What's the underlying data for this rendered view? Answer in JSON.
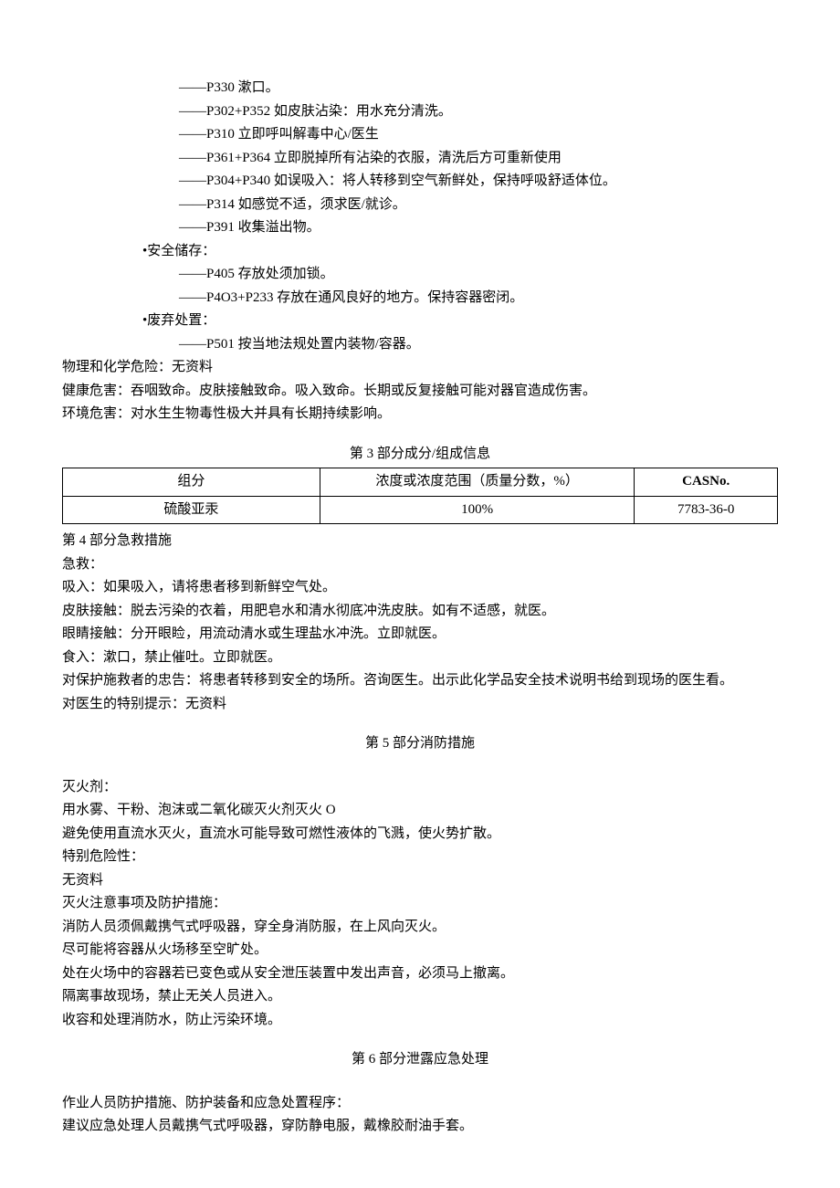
{
  "response_lines": [
    "——P330 漱口。",
    "",
    "——P302+P352 如皮肤沾染：用水充分清洗。",
    "——P310 立即呼叫解毒中心/医生",
    "——P361+P364 立即脱掉所有沾染的衣服，清洗后方可重新使用",
    "——P304+P340 如误吸入：将人转移到空气新鲜处，保持呼吸舒适体位。",
    "——P314 如感觉不适，须求医/就诊。",
    "——P391 收集溢出物。"
  ],
  "storage_label": "•安全储存：",
  "storage_lines": [
    "——P405 存放处须加锁。",
    "——P4O3+P233 存放在通风良好的地方。保持容器密闭。"
  ],
  "disposal_label": "•废弃处置：",
  "disposal_lines": [
    "——P501 按当地法规处置内装物/容器。"
  ],
  "hazard_lines": [
    "物理和化学危险：无资料",
    "健康危害：吞咽致命。皮肤接触致命。吸入致命。长期或反复接触可能对器官造成伤害。",
    "环境危害：对水生生物毒性极大并具有长期持续影响。"
  ],
  "section3": {
    "title": "第 3 部分成分/组成信息",
    "headers": {
      "c1": "组分",
      "c2": "浓度或浓度范围（质量分数，%）",
      "c3": "CASNo."
    },
    "row": {
      "c1": "硫酸亚汞",
      "c2": "100%",
      "c3": "7783-36-0"
    }
  },
  "section4": {
    "title": "第 4 部分急救措施",
    "lines": [
      "急救：",
      "吸入：如果吸入，请将患者移到新鲜空气处。",
      "皮肤接触：脱去污染的衣着，用肥皂水和清水彻底冲洗皮肤。如有不适感，就医。",
      "眼睛接触：分开眼睑，用流动清水或生理盐水冲洗。立即就医。",
      "食入：漱口，禁止催吐。立即就医。",
      "对保护施救者的忠告：将患者转移到安全的场所。咨询医生。出示此化学品安全技术说明书给到现场的医生看。",
      "对医生的特别提示：无资料"
    ]
  },
  "section5": {
    "title": "第 5 部分消防措施",
    "lines": [
      "灭火剂：",
      "用水雾、干粉、泡沫或二氧化碳灭火剂灭火 O",
      "避免使用直流水灭火，直流水可能导致可燃性液体的飞溅，使火势扩散。",
      "特别危险性：",
      "无资料",
      "灭火注意事项及防护措施：",
      "消防人员须佩戴携气式呼吸器，穿全身消防服，在上风向灭火。",
      "尽可能将容器从火场移至空旷处。",
      "处在火场中的容器若已变色或从安全泄压装置中发出声音，必须马上撤离。",
      "隔离事故现场，禁止无关人员进入。",
      "收容和处理消防水，防止污染环境。"
    ]
  },
  "section6": {
    "title": "第 6 部分泄露应急处理",
    "lines": [
      "作业人员防护措施、防护装备和应急处置程序：",
      "建议应急处理人员戴携气式呼吸器，穿防静电服，戴橡胶耐油手套。"
    ]
  }
}
